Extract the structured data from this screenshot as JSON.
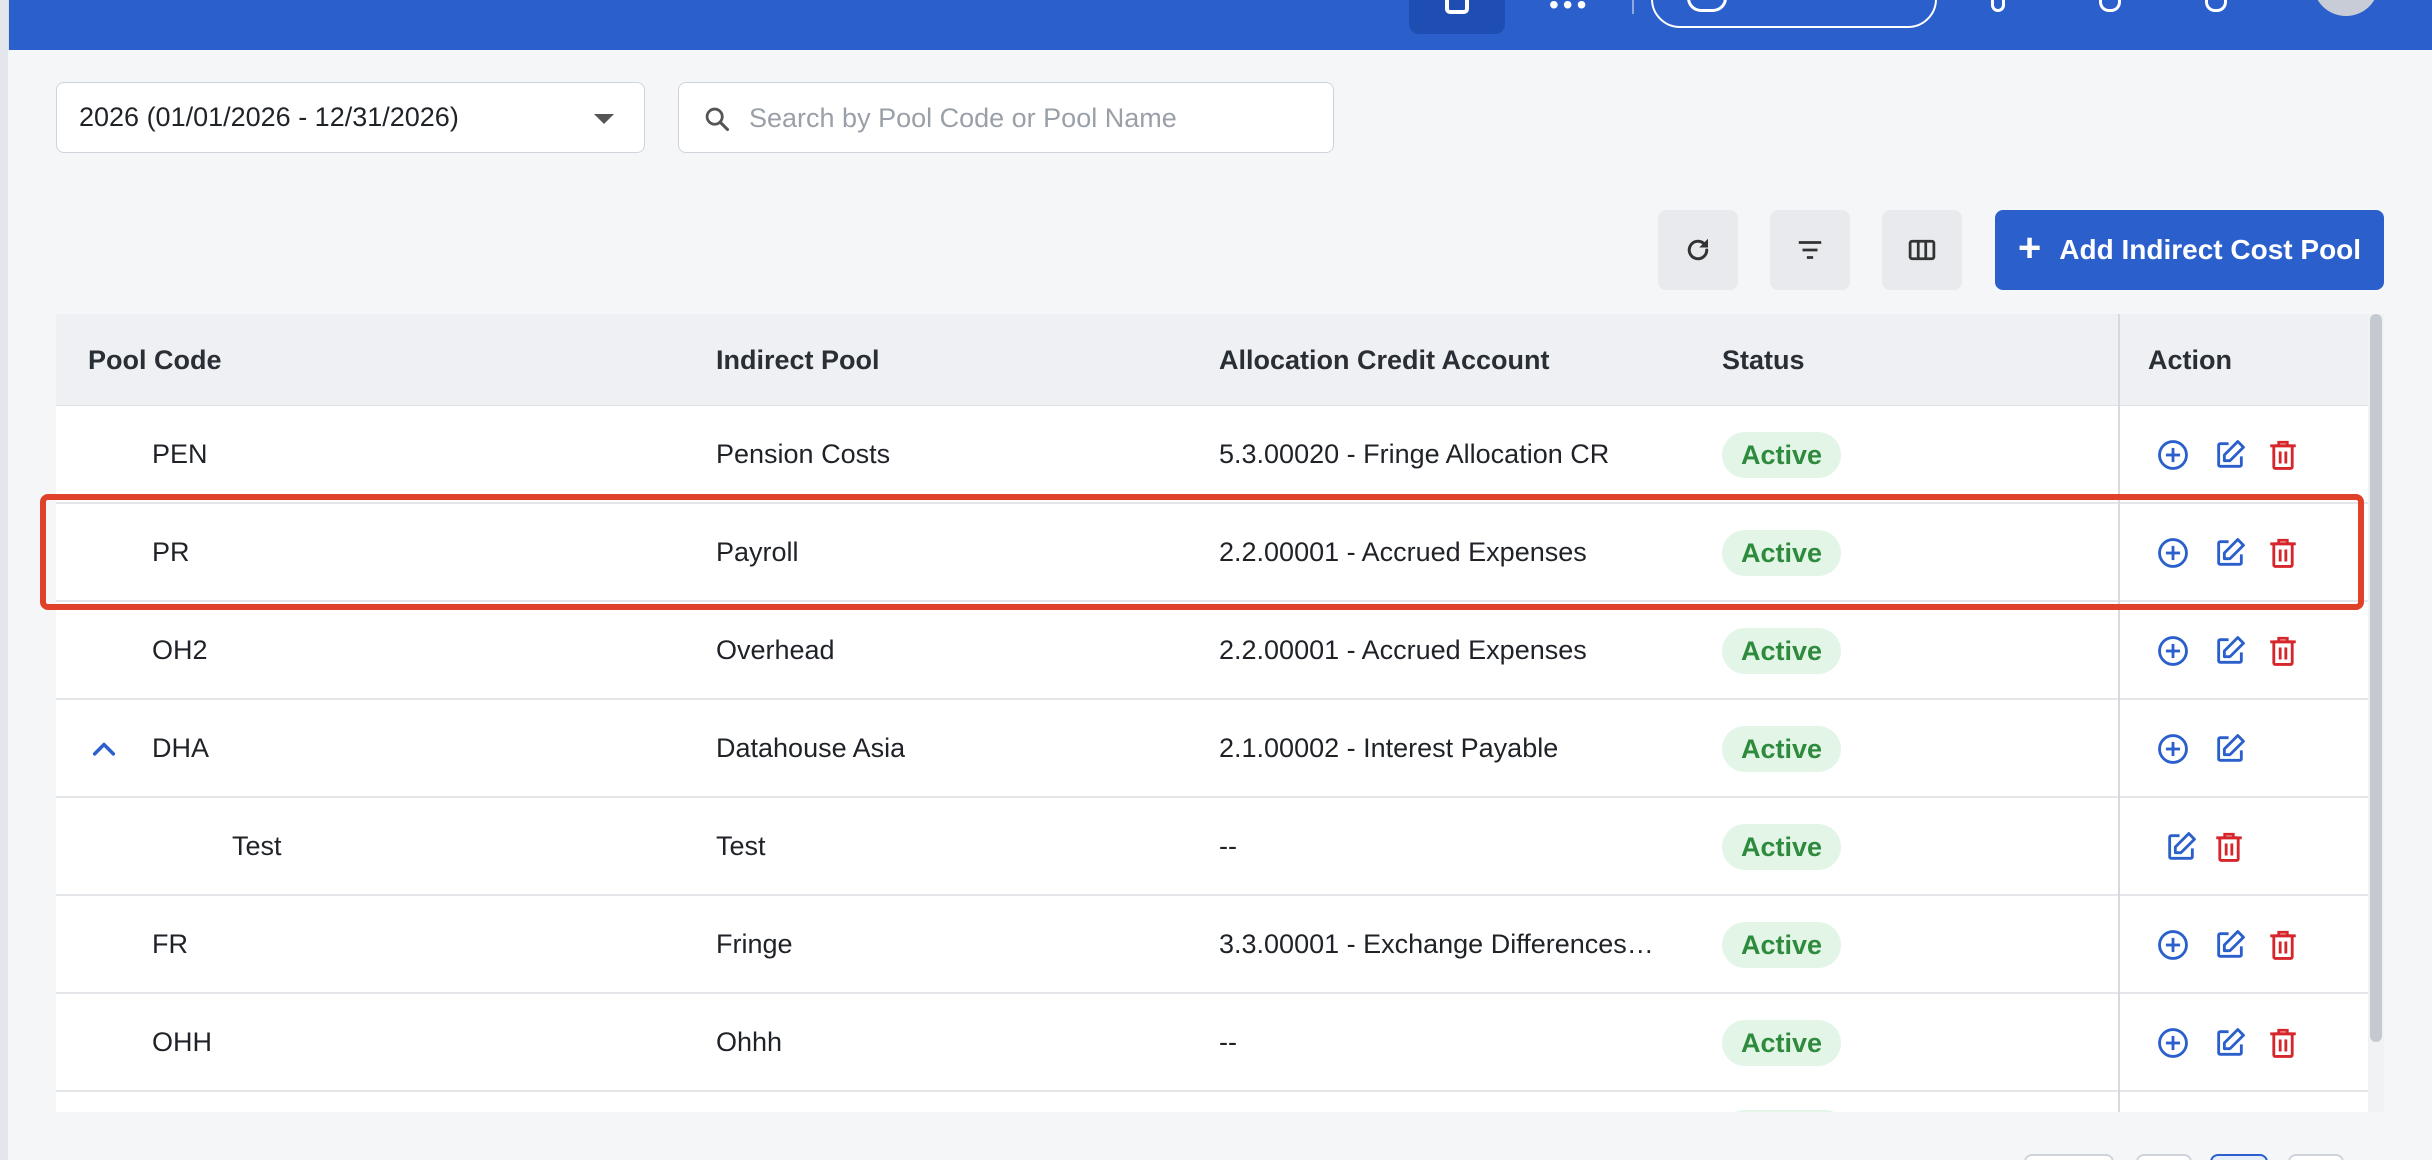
{
  "filters": {
    "year_value": "2026 (01/01/2026 - 12/31/2026)",
    "search_placeholder": "Search by Pool Code or Pool Name"
  },
  "toolbar": {
    "add_label": "Add Indirect Cost Pool",
    "refresh_icon": "refresh-icon",
    "filter_icon": "filter-icon",
    "columns_icon": "columns-icon"
  },
  "table": {
    "headers": [
      "Pool Code",
      "Indirect Pool",
      "Allocation Credit Account",
      "Status",
      "Action"
    ],
    "rows": [
      {
        "code": "PEN",
        "pool": "Pension Costs",
        "account": "5.3.00020 - Fringe Allocation CR",
        "status": "Active"
      },
      {
        "code": "PR",
        "pool": "Payroll",
        "account": "2.2.00001 - Accrued Expenses",
        "status": "Active"
      },
      {
        "code": "OH2",
        "pool": "Overhead",
        "account": "2.2.00001 - Accrued Expenses",
        "status": "Active"
      },
      {
        "code": "DHA",
        "pool": "Datahouse Asia",
        "account": "2.1.00002 - Interest Payable",
        "status": "Active"
      },
      {
        "code": "Test",
        "pool": "Test",
        "account": "--",
        "status": "Active"
      },
      {
        "code": "FR",
        "pool": "Fringe",
        "account": "3.3.00001 - Exchange Differences…",
        "status": "Active"
      },
      {
        "code": "OHH",
        "pool": "Ohhh",
        "account": "--",
        "status": "Active"
      }
    ]
  },
  "colors": {
    "primary": "#2b5fcb",
    "status_active_bg": "#e3f5e6",
    "status_active_text": "#2e8b3d",
    "delete": "#d6262b",
    "highlight": "#e0412b"
  }
}
